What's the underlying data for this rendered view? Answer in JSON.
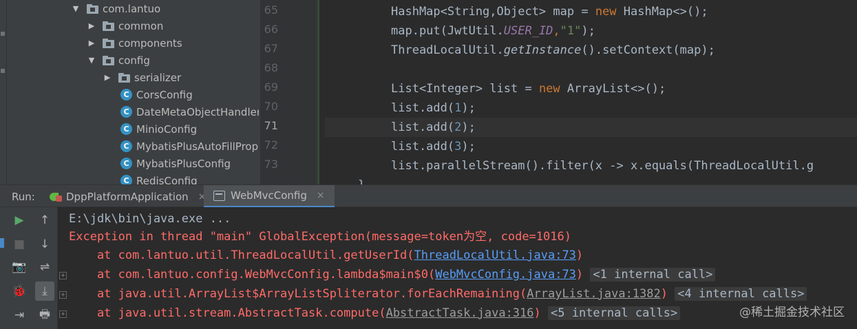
{
  "project_tree": {
    "items": [
      {
        "label": "com.lantuo",
        "kind": "package",
        "arrow": "expanded"
      },
      {
        "label": "common",
        "kind": "package",
        "arrow": "collapsed"
      },
      {
        "label": "components",
        "kind": "package",
        "arrow": "collapsed"
      },
      {
        "label": "config",
        "kind": "package",
        "arrow": "expanded"
      },
      {
        "label": "serializer",
        "kind": "package",
        "arrow": "collapsed"
      },
      {
        "label": "CorsConfig",
        "kind": "class"
      },
      {
        "label": "DateMetaObjectHandler",
        "kind": "class"
      },
      {
        "label": "MinioConfig",
        "kind": "class"
      },
      {
        "label": "MybatisPlusAutoFillProperties",
        "kind": "class"
      },
      {
        "label": "MybatisPlusConfig",
        "kind": "class"
      },
      {
        "label": "RedisConfig",
        "kind": "class"
      }
    ],
    "class_icon_letter": "C"
  },
  "editor": {
    "line_numbers": [
      "65",
      "66",
      "67",
      "68",
      "69",
      "70",
      "71",
      "72",
      "73"
    ],
    "current_line": "71",
    "lines": {
      "l65": {
        "a": "HashMap<String,Object> map = ",
        "kw": "new",
        "b": " HashMap<>();"
      },
      "l66": {
        "a": "map.put(JwtUtil.",
        "field": "USER_ID",
        "c": ",",
        "str": "\"1\"",
        "d": ");"
      },
      "l67": {
        "a": "ThreadLocalUtil.",
        "method": "getInstance",
        "b": "().setContext(map);"
      },
      "l69": {
        "a": "List<Integer> list = ",
        "kw": "new",
        "b": " ArrayList<>();"
      },
      "l70": {
        "a": "list.add(",
        "num": "1",
        "b": ");"
      },
      "l71": {
        "a": "list.add(",
        "num": "2",
        "b": ");"
      },
      "l72": {
        "a": "list.add(",
        "num": "3",
        "b": ");"
      },
      "l73": {
        "a": "list.parallelStream().filter(x -> x.equals(ThreadLocalUtil.g"
      },
      "l74": {
        "a": "}"
      }
    }
  },
  "run_panel": {
    "label": "Run:",
    "tabs": [
      {
        "label": "DppPlatformApplication",
        "icon": "spring-app-icon",
        "active": false
      },
      {
        "label": "WebMvcConfig",
        "icon": "config-icon",
        "active": true
      }
    ],
    "close_glyph": "×"
  },
  "toolbar": {
    "rerun": "▶",
    "stop": "■",
    "camera": "📷",
    "bug": "🐞",
    "exit": "⇥",
    "up": "↑",
    "down": "↓",
    "soft_wrap": "⇌",
    "scroll_end": "⤓",
    "print": "🖶"
  },
  "console": {
    "command": "E:\\jdk\\bin\\java.exe ...",
    "exception": "Exception in thread \"main\" GlobalException(message=token为空, code=1016)",
    "frames": [
      {
        "text": "    at com.lantuo.util.ThreadLocalUtil.getUserId(",
        "link": "ThreadLocalUtil.java:73",
        "link_style": "blue",
        "tail": ")",
        "internal": ""
      },
      {
        "text": "    at com.lantuo.config.WebMvcConfig.lambda$main$0(",
        "link": "WebMvcConfig.java:73",
        "link_style": "blue",
        "tail": ")",
        "internal": "<1 internal call>"
      },
      {
        "text": "    at java.util.ArrayList$ArrayListSpliterator.forEachRemaining(",
        "link": "ArrayList.java:1382",
        "link_style": "gray",
        "tail": ")",
        "internal": "<4 internal calls>"
      },
      {
        "text": "    at java.util.stream.AbstractTask.compute(",
        "link": "AbstractTask.java:316",
        "link_style": "gray",
        "tail": ")",
        "internal": "<5 internal calls>"
      }
    ],
    "fold_glyph": "+"
  },
  "watermark": "@稀土掘金技术社区",
  "colors": {
    "background": "#2b2b2b",
    "keyword": "#cc7832",
    "string": "#6a8759",
    "number": "#6897bb",
    "field": "#9876aa",
    "error": "#ff6b68",
    "link": "#589df6",
    "accent": "#4a88c7"
  }
}
